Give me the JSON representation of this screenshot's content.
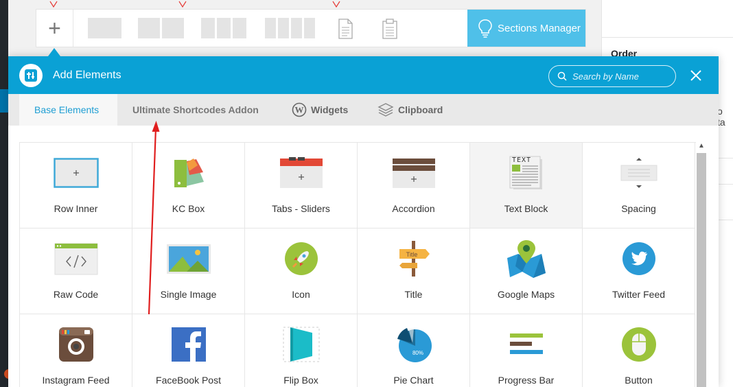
{
  "toolbar": {
    "add_symbol": "+",
    "sections_manager_label": "Sections Manager"
  },
  "sidebar_panel": {
    "order_label": "Order",
    "cut_text": "o ta"
  },
  "modal": {
    "title": "Add Elements",
    "search_placeholder": "Search by Name",
    "accent_color": "#0aa1d5",
    "tabs": [
      {
        "label": "Base Elements",
        "icon": null,
        "active": true
      },
      {
        "label": "Ultimate Shortcodes Addon",
        "icon": null,
        "active": false
      },
      {
        "label": "Widgets",
        "icon": "wordpress-icon",
        "active": false
      },
      {
        "label": "Clipboard",
        "icon": "layers-icon",
        "active": false
      }
    ],
    "elements": [
      {
        "label": "Row Inner",
        "icon": "row-inner-icon"
      },
      {
        "label": "KC Box",
        "icon": "kc-box-icon"
      },
      {
        "label": "Tabs - Sliders",
        "icon": "tabs-sliders-icon"
      },
      {
        "label": "Accordion",
        "icon": "accordion-icon"
      },
      {
        "label": "Text Block",
        "icon": "text-block-icon"
      },
      {
        "label": "Spacing",
        "icon": "spacing-icon"
      },
      {
        "label": "Raw Code",
        "icon": "raw-code-icon"
      },
      {
        "label": "Single Image",
        "icon": "single-image-icon"
      },
      {
        "label": "Icon",
        "icon": "rocket-icon"
      },
      {
        "label": "Title",
        "icon": "title-signpost-icon"
      },
      {
        "label": "Google Maps",
        "icon": "map-pin-icon"
      },
      {
        "label": "Twitter Feed",
        "icon": "twitter-icon"
      },
      {
        "label": "Instagram Feed",
        "icon": "instagram-icon"
      },
      {
        "label": "FaceBook Post",
        "icon": "facebook-icon"
      },
      {
        "label": "Flip Box",
        "icon": "flip-box-icon"
      },
      {
        "label": "Pie Chart",
        "icon": "pie-chart-icon"
      },
      {
        "label": "Progress Bar",
        "icon": "progress-bar-icon"
      },
      {
        "label": "Button",
        "icon": "mouse-button-icon"
      }
    ],
    "icon_labels": {
      "text_block": "TEXT",
      "title_sign": "Title",
      "pie_percent": "80%"
    }
  }
}
